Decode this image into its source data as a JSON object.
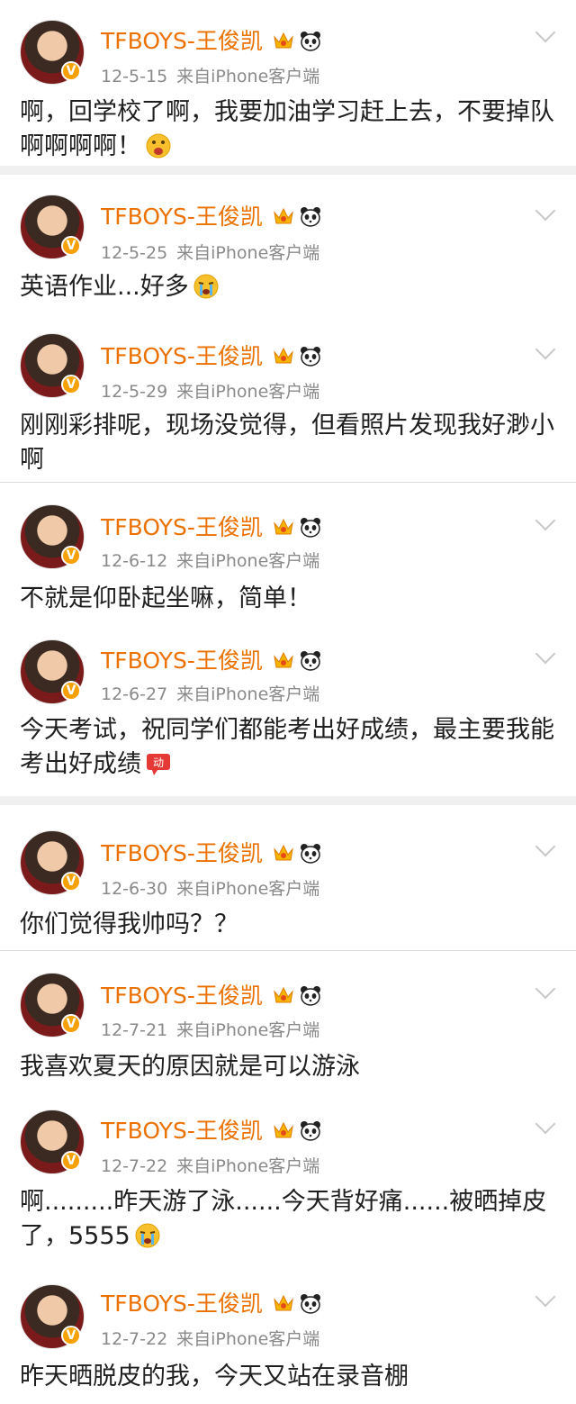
{
  "accent_color": "#eb7100",
  "posts": [
    {
      "name": "TFBOYS-王俊凯",
      "date": "12-5-15",
      "source": "来自iPhone客户端",
      "text": "啊，回学校了啊，我要加油学习赶上去，不要掉队啊啊啊啊！",
      "emoji": "scream-face-icon"
    },
    {
      "name": "TFBOYS-王俊凯",
      "date": "12-5-25",
      "source": "来自iPhone客户端",
      "text": "英语作业...好多",
      "emoji": "crying-face-icon"
    },
    {
      "name": "TFBOYS-王俊凯",
      "date": "12-5-29",
      "source": "来自iPhone客户端",
      "text": "刚刚彩排呢，现场没觉得，但看照片发现我好渺小啊"
    },
    {
      "name": "TFBOYS-王俊凯",
      "date": "12-6-12",
      "source": "来自iPhone客户端",
      "text": "不就是仰卧起坐嘛，简单！"
    },
    {
      "name": "TFBOYS-王俊凯",
      "date": "12-6-27",
      "source": "来自iPhone客户端",
      "text": "今天考试，祝同学们都能考出好成绩，最主要我能考出好成绩",
      "emoji": "jiayou-sticker-icon"
    },
    {
      "name": "TFBOYS-王俊凯",
      "date": "12-6-30",
      "source": "来自iPhone客户端",
      "text": "你们觉得我帅吗？？"
    },
    {
      "name": "TFBOYS-王俊凯",
      "date": "12-7-21",
      "source": "来自iPhone客户端",
      "text": "我喜欢夏天的原因就是可以游泳"
    },
    {
      "name": "TFBOYS-王俊凯",
      "date": "12-7-22",
      "source": "来自iPhone客户端",
      "text": "啊.........昨天游了泳......今天背好痛......被晒掉皮了，5555",
      "emoji": "crying-face-icon"
    },
    {
      "name": "TFBOYS-王俊凯",
      "date": "12-7-22",
      "source": "来自iPhone客户端",
      "text": "昨天晒脱皮的我，今天又站在录音棚"
    }
  ],
  "badges": {
    "verified": "V"
  }
}
